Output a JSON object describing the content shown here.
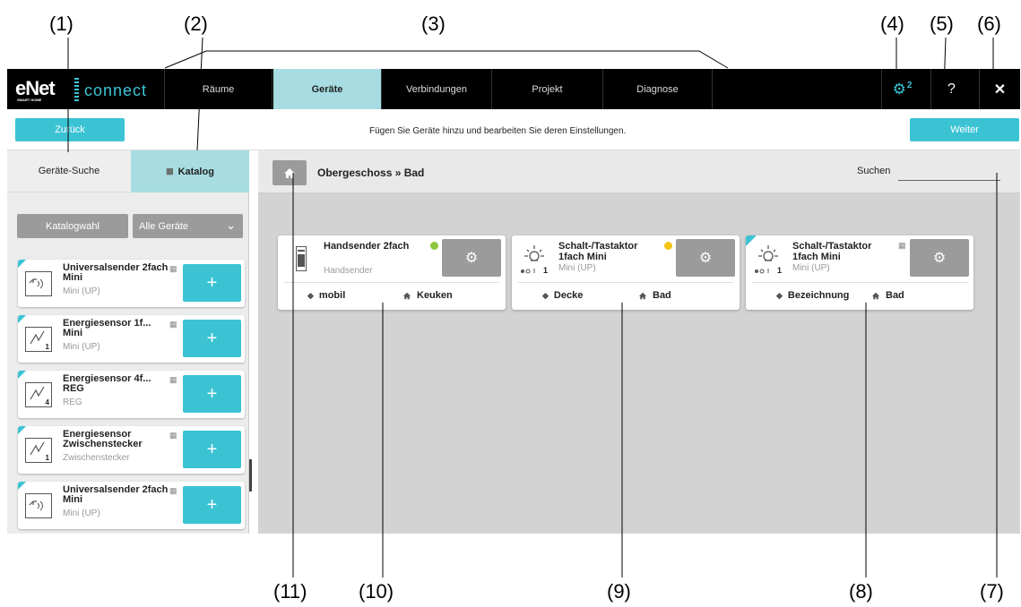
{
  "callouts": [
    "(1)",
    "(2)",
    "(3)",
    "(4)",
    "(5)",
    "(6)",
    "(7)",
    "(8)",
    "(9)",
    "(10)",
    "(11)"
  ],
  "app": {
    "logo_text": "eNet",
    "logo_sub": "SMART HOME",
    "logo_product": "connect",
    "tabs": [
      "Räume",
      "Geräte",
      "Verbindungen",
      "Projekt",
      "Diagnose"
    ],
    "active_tab": "Geräte",
    "gear_badge": "2",
    "help_label": "?",
    "close_label": "✕"
  },
  "actionbar": {
    "back_label": "Zurück",
    "info_text": "Fügen Sie Geräte hinzu und bearbeiten Sie deren Einstellungen.",
    "next_label": "Weiter"
  },
  "sidebar": {
    "tab_search": "Geräte-Suche",
    "tab_catalog": "Katalog",
    "catalog_select_label": "Katalogwahl",
    "filter_value": "Alle Geräte",
    "items": [
      {
        "name": "Universalsender 2fach Mini",
        "sub": "Mini (UP)",
        "icon": "remote-icon"
      },
      {
        "name": "Energiesensor 1f... Mini",
        "sub": "Mini (UP)",
        "icon": "energy-sensor-icon",
        "icon_index": "1"
      },
      {
        "name": "Energiesensor 4f... REG",
        "sub": "REG",
        "icon": "energy-sensor-icon",
        "icon_index": "4"
      },
      {
        "name": "Energiesensor Zwischenstecker",
        "sub": "Zwischenstecker",
        "icon": "energy-sensor-icon",
        "icon_index": "1"
      },
      {
        "name": "Universalsender 2fach Mini",
        "sub": "Mini (UP)",
        "icon": "remote-icon"
      }
    ],
    "add_label": "+"
  },
  "main": {
    "breadcrumb": "Obergeschoss » Bad",
    "search_label": "Suchen",
    "search_value": "",
    "cards": [
      {
        "title": "Handsender 2fach",
        "sub": "Handsender",
        "status_color": "#8cc63f",
        "tag": "mobil",
        "room": "Keuken",
        "icon": "handheld-remote-icon"
      },
      {
        "title": "Schalt-/Tastaktor 1fach Mini",
        "sub": "Mini (UP)",
        "status_color": "#f5c518",
        "tag": "Decke",
        "room": "Bad",
        "icon": "lamp-icon",
        "channel": "1"
      },
      {
        "title": "Schalt-/Tastaktor 1fach Mini",
        "sub": "Mini (UP)",
        "tag": "Bezeichnung",
        "room": "Bad",
        "icon": "lamp-icon",
        "channel": "1"
      }
    ]
  },
  "colors": {
    "accent": "#3bc3d4",
    "active_tab": "#a7dde2",
    "gray_button": "#9b9b9b",
    "topbar": "#000000"
  }
}
